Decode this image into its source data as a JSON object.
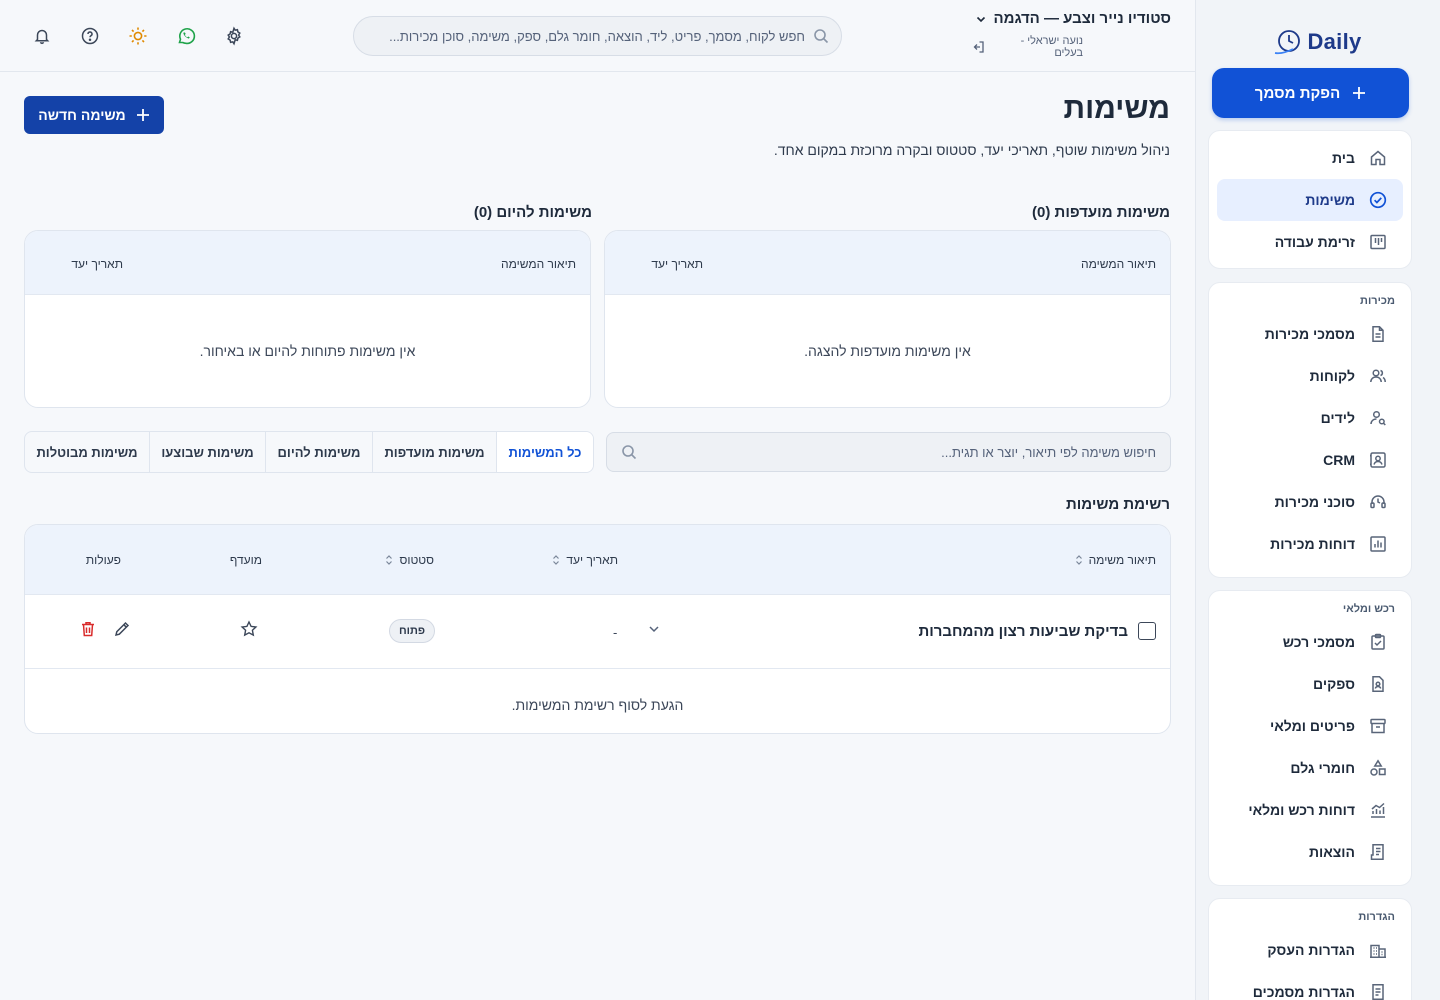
{
  "sidebar": {
    "logo_text": "Daily",
    "primary_action": "הפקת מסמך",
    "groups": [
      {
        "title": "",
        "items": [
          {
            "label": "בית",
            "icon": "home-icon",
            "active": false
          },
          {
            "label": "משימות",
            "icon": "check-circle-icon",
            "active": true
          },
          {
            "label": "זרימת עבודה",
            "icon": "kanban-icon",
            "active": false
          }
        ]
      },
      {
        "title": "מכירות",
        "items": [
          {
            "label": "מסמכי מכירות",
            "icon": "document-icon"
          },
          {
            "label": "לקוחות",
            "icon": "users-icon"
          },
          {
            "label": "לידים",
            "icon": "user-search-icon"
          },
          {
            "label": "CRM",
            "icon": "contact-card-icon"
          },
          {
            "label": "סוכני מכירות",
            "icon": "headset-icon"
          },
          {
            "label": "דוחות מכירות",
            "icon": "bar-chart-icon"
          }
        ]
      },
      {
        "title": "רכש ומלאי",
        "items": [
          {
            "label": "מסמכי רכש",
            "icon": "clipboard-check-icon"
          },
          {
            "label": "ספקים",
            "icon": "supplier-file-icon"
          },
          {
            "label": "פריטים ומלאי",
            "icon": "archive-box-icon"
          },
          {
            "label": "חומרי גלם",
            "icon": "shapes-icon"
          },
          {
            "label": "דוחות רכש ומלאי",
            "icon": "trend-chart-icon"
          },
          {
            "label": "הוצאות",
            "icon": "receipt-icon"
          }
        ]
      },
      {
        "title": "הגדרות",
        "items": [
          {
            "label": "הגדרות העסק",
            "icon": "building-icon"
          },
          {
            "label": "הגדרות מסמכים",
            "icon": "document-settings-icon"
          }
        ]
      }
    ]
  },
  "topbar": {
    "org_name": "סטודיו נייר וצבע — הדגמה",
    "user_line": "נועה ישראלי - בעלים",
    "search_placeholder": "חפש לקוח, מסמך, פריט, ליד, הוצאה, חומר גלם, ספק, משימה, סוכן מכירות..."
  },
  "page": {
    "title": "משימות",
    "subtitle": "ניהול משימות שוטף, תאריכי יעד, סטטוס ובקרה מרוכזת במקום אחד.",
    "new_task_label": "משימה חדשה"
  },
  "panels": {
    "preferred": {
      "title": "משימות מועדפות (0)",
      "col_desc": "תיאור המשימה",
      "col_due": "תאריך יעד",
      "empty": "אין משימות מועדפות להצגה."
    },
    "today": {
      "title": "משימות להיום (0)",
      "col_desc": "תיאור המשימה",
      "col_due": "תאריך יעד",
      "empty": "אין משימות פתוחות להיום או באיחור."
    }
  },
  "tabs": [
    {
      "label": "כל המשימות",
      "active": true
    },
    {
      "label": "משימות מועדפות"
    },
    {
      "label": "משימות להיום"
    },
    {
      "label": "משימות שבוצעו"
    },
    {
      "label": "משימות מבוטלות"
    }
  ],
  "table_search_placeholder": "חיפוש משימה לפי תיאור, יוצר או תגית...",
  "task_list": {
    "title": "רשימת משימות",
    "columns": {
      "desc": "תיאור משימה",
      "due": "תאריך יעד",
      "status": "סטטוס",
      "preferred": "מועדף",
      "actions": "פעולות"
    },
    "rows": [
      {
        "name": "בדיקת שביעות רצון מהמחברות",
        "due": "-",
        "status": "פתוח"
      }
    ],
    "end_text": "הגעת לסוף רשימת המשימות."
  },
  "colors": {
    "accent": "#1152d6",
    "accent_dark": "#1442a8",
    "sun": "#e08a00",
    "whatsapp": "#1fa34a",
    "danger": "#d92b2b"
  }
}
